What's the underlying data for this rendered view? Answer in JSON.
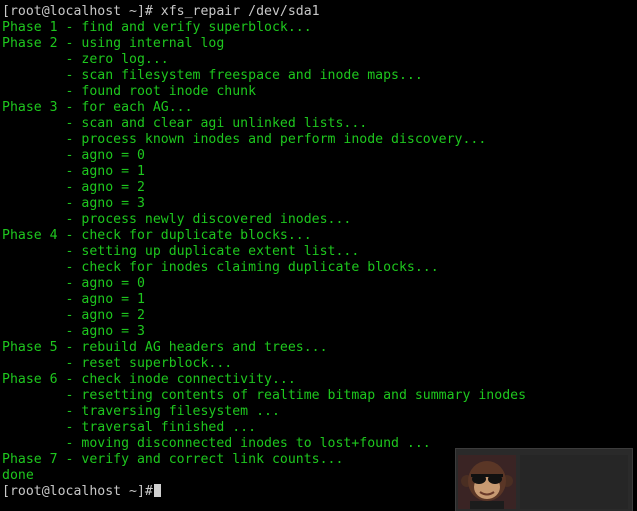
{
  "terminal": {
    "lines": [
      {
        "text": "[root@localhost ~]# xfs_repair /dev/sda1",
        "type": "prompt"
      },
      {
        "text": "Phase 1 - find and verify superblock...",
        "type": "output"
      },
      {
        "text": "Phase 2 - using internal log",
        "type": "output"
      },
      {
        "text": "        - zero log...",
        "type": "output"
      },
      {
        "text": "        - scan filesystem freespace and inode maps...",
        "type": "output"
      },
      {
        "text": "        - found root inode chunk",
        "type": "output"
      },
      {
        "text": "Phase 3 - for each AG...",
        "type": "output"
      },
      {
        "text": "        - scan and clear agi unlinked lists...",
        "type": "output"
      },
      {
        "text": "        - process known inodes and perform inode discovery...",
        "type": "output"
      },
      {
        "text": "        - agno = 0",
        "type": "output"
      },
      {
        "text": "        - agno = 1",
        "type": "output"
      },
      {
        "text": "        - agno = 2",
        "type": "output"
      },
      {
        "text": "        - agno = 3",
        "type": "output"
      },
      {
        "text": "        - process newly discovered inodes...",
        "type": "output"
      },
      {
        "text": "Phase 4 - check for duplicate blocks...",
        "type": "output"
      },
      {
        "text": "        - setting up duplicate extent list...",
        "type": "output"
      },
      {
        "text": "        - check for inodes claiming duplicate blocks...",
        "type": "output"
      },
      {
        "text": "        - agno = 0",
        "type": "output"
      },
      {
        "text": "        - agno = 1",
        "type": "output"
      },
      {
        "text": "        - agno = 2",
        "type": "output"
      },
      {
        "text": "        - agno = 3",
        "type": "output"
      },
      {
        "text": "Phase 5 - rebuild AG headers and trees...",
        "type": "output"
      },
      {
        "text": "        - reset superblock...",
        "type": "output"
      },
      {
        "text": "Phase 6 - check inode connectivity...",
        "type": "output"
      },
      {
        "text": "        - resetting contents of realtime bitmap and summary inodes",
        "type": "output"
      },
      {
        "text": "        - traversing filesystem ...",
        "type": "output"
      },
      {
        "text": "        - traversal finished ...",
        "type": "output"
      },
      {
        "text": "        - moving disconnected inodes to lost+found ...",
        "type": "output"
      },
      {
        "text": "Phase 7 - verify and correct link counts...",
        "type": "output"
      },
      {
        "text": "done",
        "type": "output"
      },
      {
        "text": "[root@localhost ~]#",
        "type": "prompt",
        "cursor": true
      }
    ],
    "colors": {
      "background": "#000000",
      "output_text": "#1ec71e",
      "prompt_text": "#c8c8c8"
    }
  },
  "webcam_overlay": {
    "icon": "monkey-with-sunglasses-avatar"
  }
}
